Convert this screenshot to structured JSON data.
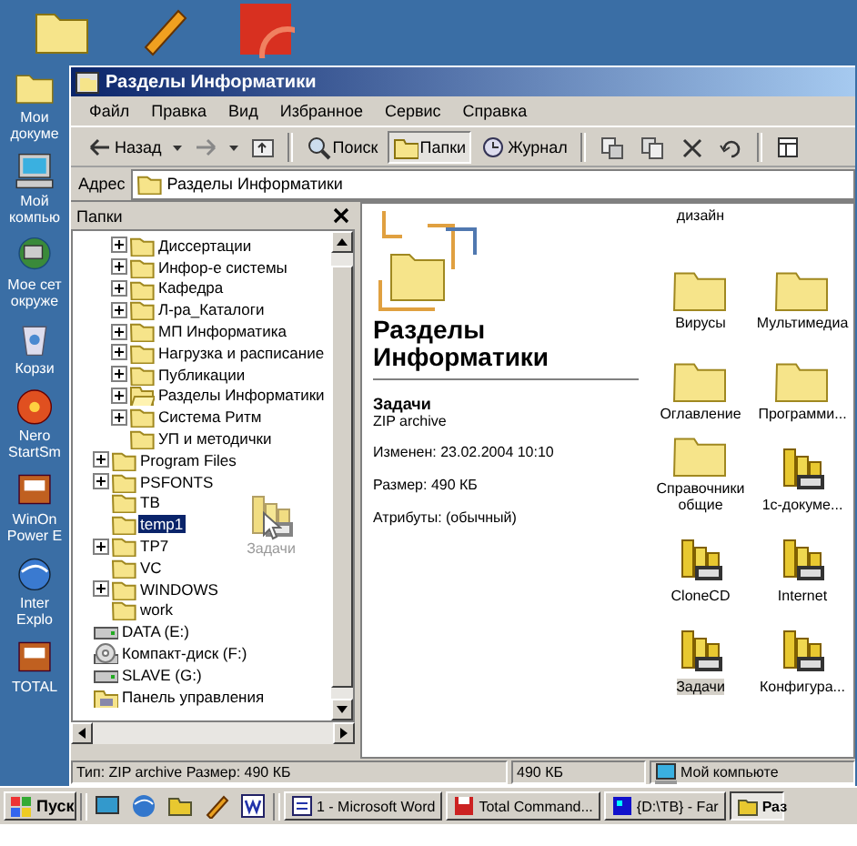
{
  "desktop": {
    "top_icons": [
      {
        "kind": "folder"
      },
      {
        "kind": "shortcut-app"
      },
      {
        "kind": "shortcut-red"
      }
    ],
    "side_icons": [
      {
        "kind": "folder",
        "lines": [
          "Мои",
          "докуме"
        ]
      },
      {
        "kind": "computer",
        "lines": [
          "Мой",
          "компью"
        ]
      },
      {
        "kind": "network",
        "lines": [
          "Мое сет",
          "окруже"
        ]
      },
      {
        "kind": "bin",
        "lines": [
          "Корзи"
        ]
      },
      {
        "kind": "disc",
        "lines": [
          "Nero",
          "StartSm"
        ]
      },
      {
        "kind": "app",
        "lines": [
          "WinOn",
          "Power E"
        ]
      },
      {
        "kind": "globe",
        "lines": [
          "Inter",
          "Explo"
        ]
      },
      {
        "kind": "app",
        "lines": [
          "TOTAL"
        ]
      }
    ]
  },
  "window": {
    "title": "Разделы Информатики",
    "menu": [
      "Файл",
      "Правка",
      "Вид",
      "Избранное",
      "Сервис",
      "Справка"
    ],
    "toolbar": [
      {
        "kind": "back",
        "label": "Назад",
        "pressed": false
      },
      {
        "kind": "forward",
        "pressed": false
      },
      {
        "kind": "up",
        "pressed": false
      },
      {
        "kind": "search",
        "label": "Поиск",
        "pressed": false
      },
      {
        "kind": "folders",
        "label": "Папки",
        "pressed": true
      },
      {
        "kind": "history",
        "label": "Журнал",
        "pressed": false
      },
      {
        "kind": "move",
        "pressed": false
      },
      {
        "kind": "copy",
        "pressed": false
      },
      {
        "kind": "delete",
        "pressed": false
      },
      {
        "kind": "undo",
        "pressed": false
      },
      {
        "kind": "views",
        "pressed": false
      }
    ],
    "address": {
      "label": "Адрес",
      "value": "Разделы Информатики"
    },
    "folders_pane": {
      "title": "Папки",
      "tree": [
        {
          "children": [
            {
              "children": [
                {
                  "label": "Диссертации",
                  "kind": "folder",
                  "expandable": true,
                  "selected": false
                },
                {
                  "label": "Инфор-е системы",
                  "kind": "folder",
                  "expandable": true,
                  "selected": false
                },
                {
                  "label": "Кафедра",
                  "kind": "folder",
                  "expandable": true,
                  "selected": false
                },
                {
                  "label": "Л-ра_Каталоги",
                  "kind": "folder",
                  "expandable": true,
                  "selected": false
                },
                {
                  "label": "МП Информатика",
                  "kind": "folder",
                  "expandable": true,
                  "selected": false
                },
                {
                  "label": "Нагрузка и расписание",
                  "kind": "folder",
                  "expandable": true,
                  "selected": false
                },
                {
                  "label": "Публикации",
                  "kind": "folder",
                  "expandable": true,
                  "selected": false
                },
                {
                  "label": "Разделы Информатики",
                  "kind": "open-folder",
                  "expandable": true,
                  "selected": false
                },
                {
                  "label": "Система  Ритм",
                  "kind": "folder",
                  "expandable": true,
                  "selected": false
                },
                {
                  "label": "УП и методички",
                  "kind": "folder",
                  "expandable": false,
                  "selected": false
                }
              ]
            },
            {
              "label": "Program Files",
              "kind": "folder",
              "expandable": true,
              "selected": false
            },
            {
              "label": "PSFONTS",
              "kind": "folder",
              "expandable": true,
              "selected": false
            },
            {
              "label": "TB",
              "kind": "folder",
              "expandable": false,
              "selected": false
            },
            {
              "label": "temp1",
              "kind": "folder",
              "expandable": false,
              "selected": true
            },
            {
              "label": "TP7",
              "kind": "folder",
              "expandable": true,
              "selected": false
            },
            {
              "label": "VC",
              "kind": "folder",
              "expandable": false,
              "selected": false
            },
            {
              "label": "WINDOWS",
              "kind": "folder",
              "expandable": true,
              "selected": false
            },
            {
              "label": "work",
              "kind": "folder",
              "expandable": false,
              "selected": false
            }
          ]
        },
        {
          "label": "DATA (E:)",
          "kind": "drive",
          "expandable": false,
          "selected": false
        },
        {
          "label": "Компакт-диск (F:)",
          "kind": "cd",
          "expandable": false,
          "selected": false
        },
        {
          "label": "SLAVE (G:)",
          "kind": "drive",
          "expandable": false,
          "selected": false
        },
        {
          "label": "Панель управления",
          "kind": "control-panel",
          "expandable": false,
          "selected": false
        }
      ],
      "drag_ghost": {
        "label": "Задачи"
      }
    },
    "info": {
      "heading": "Разделы Информатики",
      "name": "Задачи",
      "type": "ZIP archive",
      "modified": "Изменен: 23.02.2004 10:10",
      "size": "Размер: 490 КБ",
      "attributes": "Атрибуты: (обычный)"
    },
    "items": [
      {
        "kind": "cut",
        "label": "дизайн",
        "selected": false
      },
      {
        "kind": "folder",
        "label": "Вирусы",
        "selected": false
      },
      {
        "kind": "folder",
        "label": "Мультимедиа",
        "selected": false
      },
      {
        "kind": "folder",
        "label": "Оглавление",
        "selected": false
      },
      {
        "kind": "folder",
        "label": "Программи...",
        "selected": false
      },
      {
        "kind": "folder",
        "label": "Справочники общие",
        "selected": false
      },
      {
        "kind": "zip",
        "label": "1с-докуме...",
        "selected": false
      },
      {
        "kind": "zip",
        "label": "CloneCD",
        "selected": false
      },
      {
        "kind": "zip",
        "label": "Internet",
        "selected": false
      },
      {
        "kind": "zip",
        "label": "Задачи",
        "selected": true
      },
      {
        "kind": "zip",
        "label": "Конфигура...",
        "selected": false
      }
    ],
    "status_bar": {
      "text": "Тип: ZIP archive Размер: 490 КБ",
      "size": "490 КБ",
      "zone": "Мой компьюте"
    }
  },
  "taskbar": {
    "start": "Пуск",
    "quick_launch": [
      {
        "kind": "desktop"
      },
      {
        "kind": "globe"
      },
      {
        "kind": "folder"
      },
      {
        "kind": "app"
      },
      {
        "kind": "word"
      }
    ],
    "tasks": [
      {
        "kind": "word",
        "label": "1 - Microsoft Word",
        "active": false
      },
      {
        "kind": "floppy",
        "label": "Total Command...",
        "active": false
      },
      {
        "kind": "far",
        "label": "{D:\\TB} - Far",
        "active": false
      },
      {
        "kind": "folder",
        "label": "Раз",
        "active": true
      }
    ]
  }
}
